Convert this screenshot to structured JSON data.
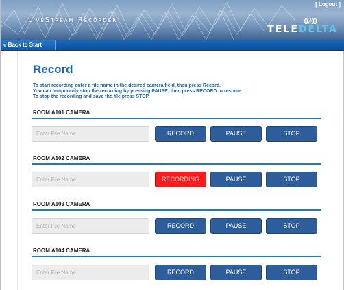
{
  "header": {
    "app_title": "LiveStream Recorder",
    "logout_label": "[ Logout ]",
    "logo_icon": "(((△)))",
    "logo_text_main": "TELE",
    "logo_text_accent": "DELTA"
  },
  "nav": {
    "back_label": "« Back to Start"
  },
  "main": {
    "title": "Record",
    "instructions": [
      "To start recording enter a file name in the desired camera field, then press Record.",
      "You can temporarily stop the recording by pressing PAUSE, then press RECORD to resume.",
      "To stop the recording and save the file press STOP."
    ],
    "cameras": [
      {
        "name": "ROOM A101 CAMERA",
        "placeholder": "Enter File Name",
        "value": "",
        "record_label": "RECORD",
        "pause_label": "PAUSE",
        "stop_label": "STOP",
        "state": "idle"
      },
      {
        "name": "ROOM A102 CAMERA",
        "placeholder": "Enter File Name",
        "value": "",
        "record_label": "RECORDING",
        "pause_label": "PAUSE",
        "stop_label": "STOP",
        "state": "recording"
      },
      {
        "name": "ROOM A103 CAMERA",
        "placeholder": "Enter File Name",
        "value": "",
        "record_label": "RECORD",
        "pause_label": "PAUSE",
        "stop_label": "STOP",
        "state": "idle"
      },
      {
        "name": "ROOM A104 CAMERA",
        "placeholder": "Enter File Name",
        "value": "",
        "record_label": "RECORD",
        "pause_label": "PAUSE",
        "stop_label": "STOP",
        "state": "idle"
      }
    ]
  },
  "colors": {
    "accent_blue": "#1b66b1",
    "button_blue": "#2d5e9b",
    "recording_red": "#ff1b1b",
    "nav_blue": "#0b4f98"
  }
}
